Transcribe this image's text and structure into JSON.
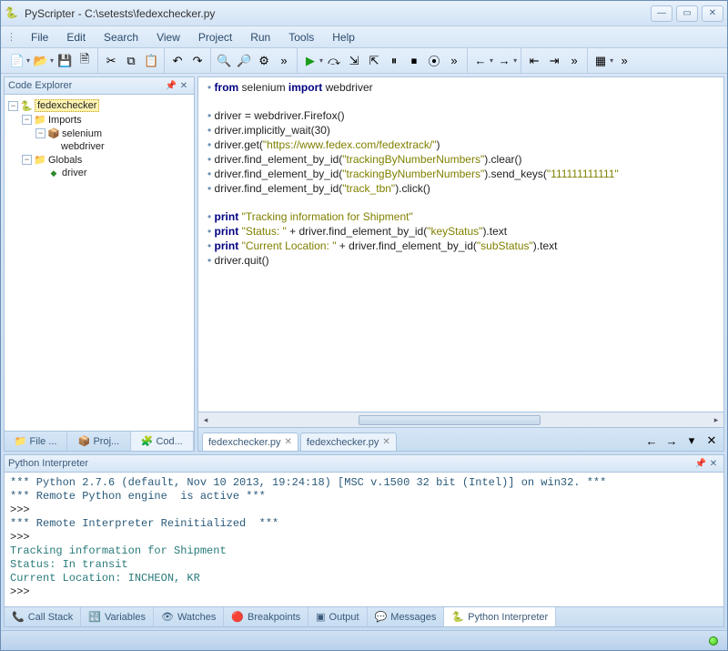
{
  "window": {
    "app_name": "PyScripter",
    "file_path": "C:\\setests\\fedexchecker.py",
    "title_sep": " - "
  },
  "menu": {
    "items": [
      "File",
      "Edit",
      "Search",
      "View",
      "Project",
      "Run",
      "Tools",
      "Help"
    ]
  },
  "code_explorer": {
    "title": "Code Explorer",
    "root": "fedexchecker",
    "imports_label": "Imports",
    "imports": [
      {
        "name": "selenium",
        "children": [
          "webdriver"
        ]
      }
    ],
    "globals_label": "Globals",
    "globals": [
      "driver"
    ]
  },
  "side_tabs": [
    {
      "label": "File ...",
      "icon": "📁"
    },
    {
      "label": "Proj...",
      "icon": "📦"
    },
    {
      "label": "Cod...",
      "icon": "🧩",
      "active": true
    }
  ],
  "editor_tabs": [
    {
      "name": "fedexchecker.py",
      "active": true
    },
    {
      "name": "fedexchecker.py",
      "active": false
    }
  ],
  "code": {
    "lines": [
      {
        "tokens": [
          [
            "kw",
            "from"
          ],
          [
            "id",
            " selenium "
          ],
          [
            "kw",
            "import"
          ],
          [
            "id",
            " webdriver"
          ]
        ]
      },
      {
        "blank": true
      },
      {
        "tokens": [
          [
            "id",
            "driver = webdriver.Firefox()"
          ]
        ]
      },
      {
        "tokens": [
          [
            "id",
            "driver.implicitly_wait(30)"
          ]
        ]
      },
      {
        "tokens": [
          [
            "id",
            "driver.get("
          ],
          [
            "str",
            "\"https://www.fedex.com/fedextrack/\""
          ],
          [
            "id",
            ")"
          ]
        ]
      },
      {
        "tokens": [
          [
            "id",
            "driver.find_element_by_id("
          ],
          [
            "str",
            "\"trackingByNumberNumbers\""
          ],
          [
            "id",
            ").clear()"
          ]
        ]
      },
      {
        "tokens": [
          [
            "id",
            "driver.find_element_by_id("
          ],
          [
            "str",
            "\"trackingByNumberNumbers\""
          ],
          [
            "id",
            ").send_keys("
          ],
          [
            "str",
            "\"111111111111\""
          ]
        ]
      },
      {
        "tokens": [
          [
            "id",
            "driver.find_element_by_id("
          ],
          [
            "str",
            "\"track_tbn\""
          ],
          [
            "id",
            ").click()"
          ]
        ]
      },
      {
        "blank": true
      },
      {
        "tokens": [
          [
            "kw",
            "print"
          ],
          [
            "id",
            " "
          ],
          [
            "str",
            "\"Tracking information for Shipment\""
          ]
        ]
      },
      {
        "tokens": [
          [
            "kw",
            "print"
          ],
          [
            "id",
            " "
          ],
          [
            "str",
            "\"Status: \""
          ],
          [
            "id",
            " + driver.find_element_by_id("
          ],
          [
            "str",
            "\"keyStatus\""
          ],
          [
            "id",
            ").text"
          ]
        ]
      },
      {
        "tokens": [
          [
            "kw",
            "print"
          ],
          [
            "id",
            " "
          ],
          [
            "str",
            "\"Current Location: \""
          ],
          [
            "id",
            " + driver.find_element_by_id("
          ],
          [
            "str",
            "\"subStatus\""
          ],
          [
            "id",
            ").text"
          ]
        ]
      },
      {
        "tokens": [
          [
            "id",
            "driver.quit()"
          ]
        ]
      }
    ]
  },
  "interpreter": {
    "title": "Python Interpreter",
    "lines": [
      {
        "cls": "banner",
        "text": "*** Python 2.7.6 (default, Nov 10 2013, 19:24:18) [MSC v.1500 32 bit (Intel)] on win32. ***"
      },
      {
        "cls": "banner",
        "text": "*** Remote Python engine  is active ***"
      },
      {
        "cls": "id",
        "text": ">>> "
      },
      {
        "cls": "banner",
        "text": "*** Remote Interpreter Reinitialized  ***"
      },
      {
        "cls": "id",
        "text": ">>> "
      },
      {
        "cls": "out",
        "text": "Tracking information for Shipment"
      },
      {
        "cls": "out",
        "text": "Status: In transit"
      },
      {
        "cls": "out",
        "text": "Current Location: INCHEON, KR"
      },
      {
        "cls": "id",
        "text": ">>> "
      }
    ]
  },
  "bottom_tabs": [
    {
      "label": "Call Stack",
      "icon": "📞"
    },
    {
      "label": "Variables",
      "icon": "🔣"
    },
    {
      "label": "Watches",
      "icon": "👁"
    },
    {
      "label": "Breakpoints",
      "icon": "🔴"
    },
    {
      "label": "Output",
      "icon": "▣"
    },
    {
      "label": "Messages",
      "icon": "💬"
    },
    {
      "label": "Python Interpreter",
      "icon": "🐍",
      "active": true
    }
  ],
  "icons": {
    "app": "🐍",
    "minimize": "—",
    "maximize": "▭",
    "close": "✕",
    "pin": "📌",
    "x": "✕",
    "module": "🐍",
    "package": "📦",
    "folder": "📁",
    "var": "◆",
    "run": "▶",
    "new": "📄",
    "open": "📂",
    "save": "💾",
    "saveall": "🗎",
    "cut": "✂",
    "copy": "⧉",
    "paste": "📋",
    "undo": "↶",
    "redo": "↷",
    "find": "🔍",
    "find2": "🔎",
    "cfg": "⚙",
    "stepover": "⤼",
    "stepin": "⇲",
    "stepout": "⇱",
    "pause": "⏸",
    "stop": "⏹",
    "break": "⦿",
    "back": "←",
    "fwd": "→",
    "outdent": "⇤",
    "indent": "⇥",
    "layout": "▦",
    "chev": "»"
  }
}
